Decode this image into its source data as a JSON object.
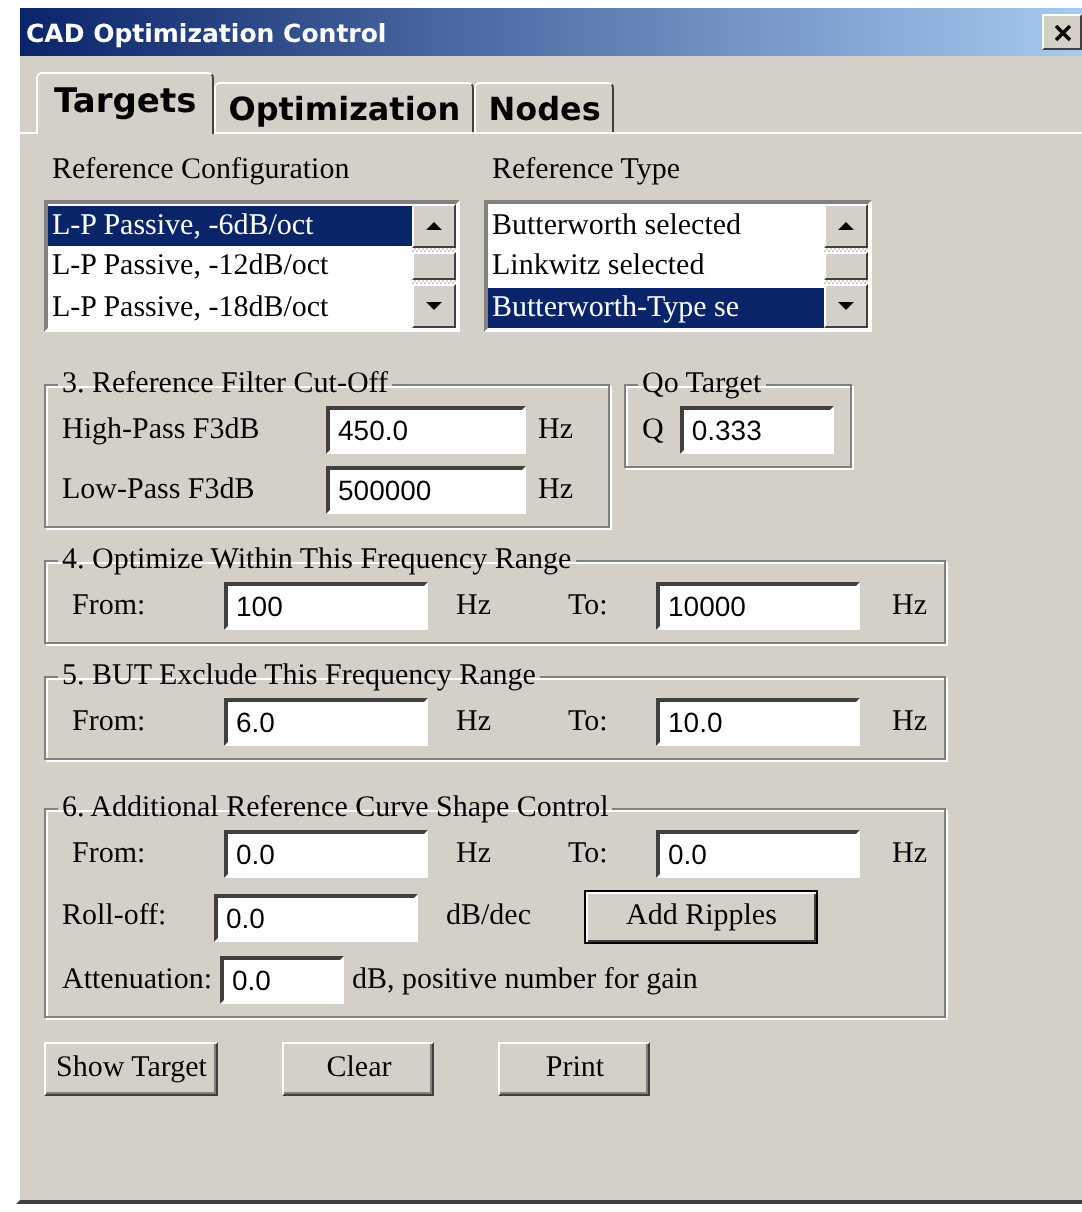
{
  "window": {
    "title": "CAD Optimization Control"
  },
  "tabs": [
    {
      "label": "Targets",
      "selected": true
    },
    {
      "label": "Optimization",
      "selected": false
    },
    {
      "label": "Nodes",
      "selected": false
    }
  ],
  "reference_configuration": {
    "label": "Reference Configuration",
    "items": [
      {
        "label": "L-P Passive, -6dB/oct",
        "selected": true
      },
      {
        "label": "L-P Passive, -12dB/oct",
        "selected": false
      },
      {
        "label": "L-P Passive, -18dB/oct",
        "selected": false
      }
    ]
  },
  "reference_type": {
    "label": "Reference Type",
    "items": [
      {
        "label": "Butterworth selected",
        "selected": false
      },
      {
        "label": "Linkwitz selected",
        "selected": false
      },
      {
        "label": "Butterworth-Type se",
        "selected": true
      }
    ]
  },
  "cutoff": {
    "title": "3. Reference Filter Cut-Off",
    "fields": [
      {
        "label": "High-Pass F3dB",
        "value": "450.0",
        "unit": "Hz"
      },
      {
        "label": "Low-Pass F3dB",
        "value": "500000",
        "unit": "Hz"
      }
    ]
  },
  "qo_target": {
    "title": "Qo Target",
    "label": "Q",
    "value": "0.333"
  },
  "optimize_range": {
    "title": "4. Optimize Within This Frequency Range",
    "from_label": "From:",
    "from": "100",
    "from_unit": "Hz",
    "to_label": "To:",
    "to": "10000",
    "to_unit": "Hz"
  },
  "exclude_range": {
    "title": "5. BUT Exclude This Frequency Range",
    "from_label": "From:",
    "from": "6.0",
    "from_unit": "Hz",
    "to_label": "To:",
    "to": "10.0",
    "to_unit": "Hz"
  },
  "shape_control": {
    "title": "6. Additional Reference Curve Shape Control",
    "from_label": "From:",
    "from": "0.0",
    "from_unit": "Hz",
    "to_label": "To:",
    "to": "0.0",
    "to_unit": "Hz",
    "rolloff": {
      "label": "Roll-off:",
      "value": "0.0",
      "unit": "dB/dec"
    },
    "add_button": "Add Ripples",
    "attenuation": {
      "label": "Attenuation:",
      "value": "0.0",
      "unit": "dB, positive number for gain"
    }
  },
  "buttons": [
    "Show Target",
    "Clear",
    "Print"
  ]
}
